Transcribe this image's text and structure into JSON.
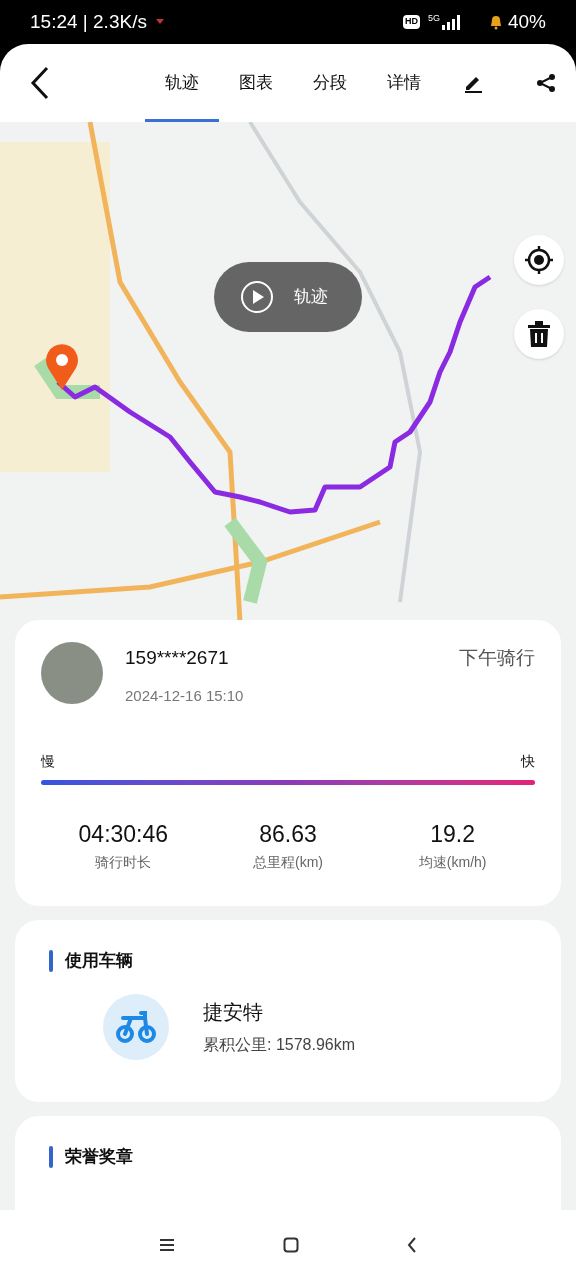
{
  "status_bar": {
    "time": "15:24 | 2.3K/s",
    "hd": "HD",
    "network": "5G",
    "battery": "40%"
  },
  "tabs": [
    {
      "label": "轨迹",
      "selected": true
    },
    {
      "label": "图表",
      "selected": false
    },
    {
      "label": "分段",
      "selected": false
    },
    {
      "label": "详情",
      "selected": false
    }
  ],
  "map": {
    "play_label": "轨迹"
  },
  "ride": {
    "user": "159****2671",
    "datetime": "2024-12-16 15:10",
    "title": "下午骑行",
    "slow": "慢",
    "fast": "快",
    "stats": [
      {
        "value": "04:30:46",
        "label": "骑行时长"
      },
      {
        "value": "86.63",
        "label": "总里程(km)"
      },
      {
        "value": "19.2",
        "label": "均速(km/h)"
      }
    ]
  },
  "vehicle": {
    "heading": "使用车辆",
    "name": "捷安特",
    "mileage": "累积公里: 1578.96km"
  },
  "medals": {
    "heading": "荣誉奖章"
  }
}
